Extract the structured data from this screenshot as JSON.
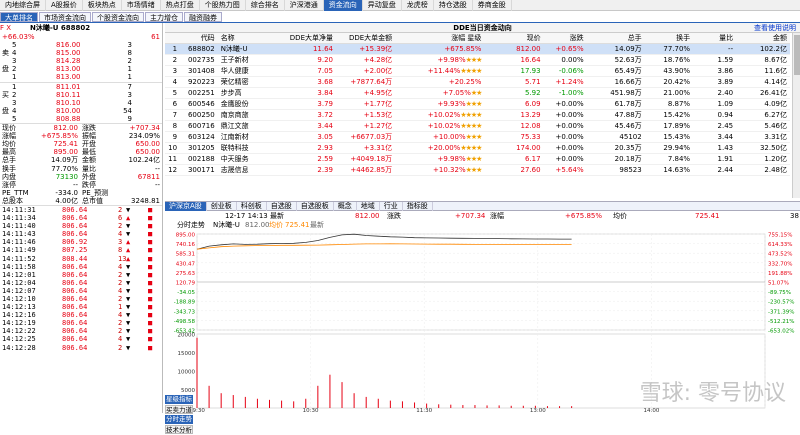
{
  "top_nav": [
    "内地综合屏",
    "A股报价",
    "板块热点",
    "市场情绪",
    "热点打盘",
    "个股热力图",
    "综合排名",
    "沪深港通",
    "资金流向",
    "异动复盘",
    "龙虎榜",
    "持仓选股",
    "券商金股"
  ],
  "top_nav_active": 8,
  "sub_tabs": [
    "大单排名",
    "市场资金流向",
    "个股资金流向",
    "主力增仓",
    "融资融券"
  ],
  "sub_tabs_active": 0,
  "stock": {
    "fx_label": "F X",
    "name_code": "N沐曦-U 688802",
    "change_pct": "+66.03%",
    "change_right": "61"
  },
  "orderbook": {
    "sell": [
      {
        "label": "",
        "level": "5",
        "price": "816.00",
        "vol": "3"
      },
      {
        "label": "卖",
        "level": "4",
        "price": "815.00",
        "vol": "8"
      },
      {
        "label": "",
        "level": "3",
        "price": "814.28",
        "vol": "2"
      },
      {
        "label": "盘",
        "level": "2",
        "price": "813.00",
        "vol": "1"
      },
      {
        "label": "",
        "level": "1",
        "price": "813.00",
        "vol": "1"
      }
    ],
    "buy": [
      {
        "label": "",
        "level": "1",
        "price": "811.01",
        "vol": "7"
      },
      {
        "label": "买",
        "level": "2",
        "price": "810.11",
        "vol": "3"
      },
      {
        "label": "",
        "level": "3",
        "price": "810.10",
        "vol": "4"
      },
      {
        "label": "盘",
        "level": "4",
        "price": "810.00",
        "vol": "54"
      },
      {
        "label": "",
        "level": "5",
        "price": "808.88",
        "vol": "9"
      }
    ]
  },
  "quote": [
    {
      "k1": "现价",
      "v1": "812.00",
      "k2": "涨跌",
      "v2": "+707.34",
      "c1": "red",
      "c2": "red"
    },
    {
      "k1": "涨幅",
      "v1": "+675.85%",
      "k2": "振幅",
      "v2": "234.09%",
      "c1": "red",
      "c2": ""
    },
    {
      "k1": "均价",
      "v1": "725.41",
      "k2": "开盘",
      "v2": "650.00",
      "c1": "red",
      "c2": "red"
    },
    {
      "k1": "最高",
      "v1": "895.00",
      "k2": "最低",
      "v2": "650.00",
      "c1": "red",
      "c2": "red"
    },
    {
      "k1": "总手",
      "v1": "14.09万",
      "k2": "金额",
      "v2": "102.24亿",
      "c1": "",
      "c2": ""
    },
    {
      "k1": "换手",
      "v1": "77.70%",
      "k2": "量比",
      "v2": "--",
      "c1": "",
      "c2": ""
    },
    {
      "k1": "内盘",
      "v1": "73130",
      "k2": "外盘",
      "v2": "67811",
      "c1": "green",
      "c2": "red"
    },
    {
      "k1": "涨停",
      "v1": "--",
      "k2": "跌停",
      "v2": "--",
      "c1": "",
      "c2": ""
    },
    {
      "k1": "PE_TTM",
      "v1": "-334.0",
      "k2": "PE_预测",
      "v2": "",
      "c1": "",
      "c2": ""
    },
    {
      "k1": "总股本",
      "v1": "4.00亿",
      "k2": "总市值",
      "v2": "3248.81",
      "c1": "",
      "c2": ""
    }
  ],
  "ticks": [
    {
      "t": "14:11:31",
      "p": "806.64",
      "v": "2",
      "d": "down"
    },
    {
      "t": "14:11:34",
      "p": "806.64",
      "v": "6",
      "d": "up"
    },
    {
      "t": "14:11:40",
      "p": "806.64",
      "v": "2",
      "d": "down"
    },
    {
      "t": "14:11:43",
      "p": "806.64",
      "v": "4",
      "d": "down"
    },
    {
      "t": "14:11:46",
      "p": "806.92",
      "v": "3",
      "d": "up"
    },
    {
      "t": "14:11:49",
      "p": "807.25",
      "v": "8",
      "d": "up"
    },
    {
      "t": "14:11:52",
      "p": "808.44",
      "v": "13",
      "d": "up"
    },
    {
      "t": "14:11:58",
      "p": "806.64",
      "v": "4",
      "d": "down"
    },
    {
      "t": "14:12:01",
      "p": "806.64",
      "v": "2",
      "d": "down"
    },
    {
      "t": "14:12:04",
      "p": "806.64",
      "v": "2",
      "d": "down"
    },
    {
      "t": "14:12:07",
      "p": "806.64",
      "v": "4",
      "d": "down"
    },
    {
      "t": "14:12:10",
      "p": "806.64",
      "v": "2",
      "d": "down"
    },
    {
      "t": "14:12:13",
      "p": "806.64",
      "v": "1",
      "d": "down"
    },
    {
      "t": "14:12:16",
      "p": "806.64",
      "v": "4",
      "d": "down"
    },
    {
      "t": "14:12:19",
      "p": "806.64",
      "v": "2",
      "d": "down"
    },
    {
      "t": "14:12:22",
      "p": "806.64",
      "v": "2",
      "d": "down"
    },
    {
      "t": "14:12:25",
      "p": "806.64",
      "v": "4",
      "d": "down"
    },
    {
      "t": "14:12:28",
      "p": "806.64",
      "v": "2",
      "d": "down"
    }
  ],
  "dde": {
    "title": "DDE当日资金动向",
    "right_link": "查看使用说明",
    "columns": [
      "",
      "代码",
      "名称",
      "DDE大单净量",
      "DDE大单金额",
      "涨幅 星级",
      "现价",
      "涨跌",
      "总手",
      "换手",
      "量比",
      "金额"
    ],
    "rows": [
      {
        "n": "1",
        "code": "688802",
        "name": "N沐曦-U",
        "net": "11.64",
        "amt": "+15.39亿",
        "pct": "+675.85%",
        "stars": "",
        "price": "812.00",
        "chg": "+0.65%",
        "vol": "14.09万",
        "turn": "77.70%",
        "ratio": "--",
        "money": "102.2亿",
        "sel": true
      },
      {
        "n": "2",
        "code": "002735",
        "name": "王子新材",
        "net": "9.20",
        "amt": "+4.28亿",
        "pct": "+9.98%",
        "stars": "★★★",
        "price": "16.64",
        "chg": "0.00%",
        "vol": "52.63万",
        "turn": "18.76%",
        "ratio": "1.59",
        "money": "8.67亿",
        "sel": false
      },
      {
        "n": "3",
        "code": "301408",
        "name": "华人健康",
        "net": "7.05",
        "amt": "+2.00亿",
        "pct": "+11.44%",
        "stars": "★★★★",
        "price": "17.93",
        "chg": "-0.06%",
        "vol": "65.49万",
        "turn": "43.90%",
        "ratio": "3.86",
        "money": "11.6亿",
        "sel": false
      },
      {
        "n": "4",
        "code": "920223",
        "name": "荣亿精密",
        "net": "3.68",
        "amt": "+7877.64万",
        "pct": "+20.25%",
        "stars": "",
        "price": "5.71",
        "chg": "+1.24%",
        "vol": "16.66万",
        "turn": "20.42%",
        "ratio": "3.89",
        "money": "4.14亿",
        "sel": false
      },
      {
        "n": "5",
        "code": "002251",
        "name": "步步高",
        "net": "3.84",
        "amt": "+4.95亿",
        "pct": "+7.05%",
        "stars": "★★",
        "price": "5.92",
        "chg": "-1.00%",
        "vol": "451.98万",
        "turn": "21.00%",
        "ratio": "2.40",
        "money": "26.41亿",
        "sel": false
      },
      {
        "n": "6",
        "code": "600546",
        "name": "金鹰股份",
        "net": "3.79",
        "amt": "+1.77亿",
        "pct": "+9.93%",
        "stars": "★★★",
        "price": "6.09",
        "chg": "+0.00%",
        "vol": "61.78万",
        "turn": "8.87%",
        "ratio": "1.09",
        "money": "4.09亿",
        "sel": false
      },
      {
        "n": "7",
        "code": "600250",
        "name": "南京商旅",
        "net": "3.72",
        "amt": "+1.53亿",
        "pct": "+10.02%",
        "stars": "★★★★",
        "price": "13.29",
        "chg": "+0.00%",
        "vol": "47.88万",
        "turn": "15.42%",
        "ratio": "0.94",
        "money": "6.27亿",
        "sel": false
      },
      {
        "n": "8",
        "code": "600716",
        "name": "鼎江文旅",
        "net": "3.44",
        "amt": "+1.27亿",
        "pct": "+10.02%",
        "stars": "★★★★",
        "price": "12.08",
        "chg": "+0.00%",
        "vol": "45.46万",
        "turn": "17.89%",
        "ratio": "2.45",
        "money": "5.46亿",
        "sel": false
      },
      {
        "n": "9",
        "code": "603124",
        "name": "江南新材",
        "net": "3.05",
        "amt": "+6677.03万",
        "pct": "+10.00%",
        "stars": "★★★",
        "price": "75.33",
        "chg": "+0.00%",
        "vol": "45102",
        "turn": "15.43%",
        "ratio": "3.44",
        "money": "3.31亿",
        "sel": false
      },
      {
        "n": "10",
        "code": "301205",
        "name": "联特科技",
        "net": "2.93",
        "amt": "+3.31亿",
        "pct": "+20.00%",
        "stars": "★★★★",
        "price": "174.00",
        "chg": "+0.00%",
        "vol": "20.35万",
        "turn": "29.94%",
        "ratio": "1.43",
        "money": "32.50亿",
        "sel": false
      },
      {
        "n": "11",
        "code": "002188",
        "name": "中天服务",
        "net": "2.59",
        "amt": "+4049.18万",
        "pct": "+9.98%",
        "stars": "★★★",
        "price": "6.17",
        "chg": "+0.00%",
        "vol": "20.18万",
        "turn": "7.84%",
        "ratio": "1.91",
        "money": "1.20亿",
        "sel": false
      },
      {
        "n": "12",
        "code": "300171",
        "name": "志晟信息",
        "net": "2.39",
        "amt": "+4462.85万",
        "pct": "+10.32%",
        "stars": "★★★",
        "price": "27.60",
        "chg": "+5.64%",
        "vol": "98523",
        "turn": "14.63%",
        "ratio": "2.44",
        "money": "2.48亿",
        "sel": false
      }
    ]
  },
  "filter_bar": [
    "沪深京A股",
    "创业板",
    "科创板",
    "自选股",
    "自选股板",
    "概念",
    "地域",
    "行业",
    "指标股"
  ],
  "filter_bar_active": 0,
  "chart_info": {
    "datetime": "12-17 14:13 最新",
    "price": "812.00",
    "change_label": "涨跌",
    "change": "+707.34",
    "pct_label": "涨幅",
    "pct": "+675.85%",
    "avg_label": "均价",
    "avg": "725.41",
    "right_num": "38"
  },
  "legend": {
    "trend": "分时走势",
    "name": "N沐曦-U",
    "p1": "812.00",
    "label_avg": "均价",
    "p2": "725.41",
    "extra": "最新"
  },
  "chart_data": {
    "type": "line",
    "y_left_ticks": [
      "895.00",
      "740.16",
      "585.31",
      "430.47",
      "275.63",
      "120.79",
      "-34.05",
      "-188.89",
      "-343.73",
      "-498.58",
      "-653.42"
    ],
    "y_right_ticks": [
      "755.15%",
      "614.33%",
      "473.52%",
      "332.70%",
      "191.88%",
      "51.07%",
      "-89.75%",
      "-230.57%",
      "-371.39%",
      "-512.21%",
      "-653.02%"
    ],
    "volume_ticks": [
      "20000",
      "15000",
      "10000",
      "5000"
    ],
    "x_ticks": [
      "09:30",
      "10:30",
      "11:30",
      "13:00",
      "14:00",
      "15:00"
    ],
    "series": [
      {
        "name": "N沐曦-U",
        "color": "#333333",
        "values": [
          650,
          700,
          720,
          735,
          728,
          730,
          738,
          742,
          745,
          760,
          790,
          840,
          880,
          892,
          870,
          860,
          850,
          845,
          835,
          832,
          830,
          828,
          826,
          824,
          822,
          820,
          818,
          816,
          815,
          814,
          813,
          812
        ]
      },
      {
        "name": "均价",
        "color": "#ff8800",
        "values": [
          650,
          670,
          690,
          700,
          705,
          708,
          710,
          712,
          713,
          714,
          716,
          720,
          726,
          732,
          735,
          736,
          737,
          736,
          734,
          732,
          731,
          730,
          729,
          728,
          727,
          727,
          726,
          726,
          725.8,
          725.6,
          725.5,
          725.41
        ]
      }
    ],
    "volume": [
      19000,
      6000,
      4000,
      3500,
      3000,
      2500,
      2200,
      2000,
      1800,
      2500,
      6000,
      9000,
      7000,
      4000,
      3000,
      2500,
      2000,
      1800,
      1500,
      1200,
      1000,
      900,
      800,
      800,
      700,
      700,
      600,
      600,
      600,
      500,
      500,
      500
    ]
  },
  "bottom_tabs": [
    "星级指标",
    "买卖力道",
    "分时走势",
    "技术分析"
  ],
  "watermark": "雪球: 零号协议"
}
